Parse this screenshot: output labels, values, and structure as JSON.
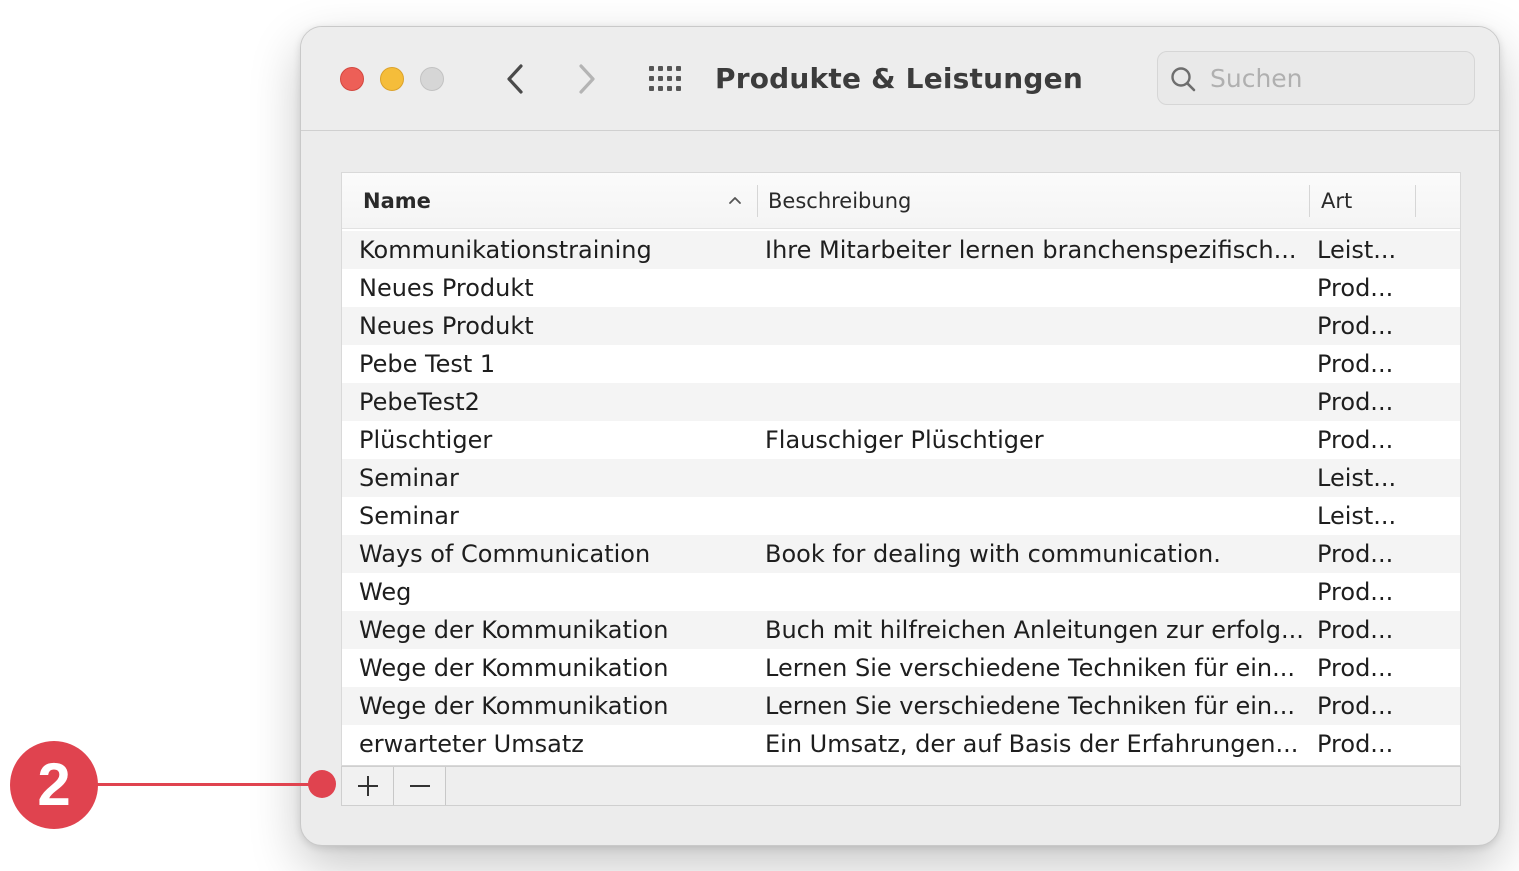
{
  "window": {
    "title": "Produkte & Leistungen",
    "search": {
      "placeholder": "Suchen",
      "value": ""
    }
  },
  "icons": {
    "close": "red-traffic-light",
    "minimize": "yellow-traffic-light",
    "zoom": "gray-traffic-light",
    "back": "chevron-left-icon",
    "forward": "chevron-right-icon",
    "grid": "grid-icon",
    "search": "magnifier-icon",
    "sort": "chevron-up-icon",
    "add": "plus-icon",
    "remove": "minus-icon"
  },
  "colors": {
    "close": "#ed5f57",
    "minimize": "#f5bd3a",
    "zoom": "#d6d6d6",
    "callout": "#e0434f"
  },
  "table": {
    "columns": {
      "name": "Name",
      "description": "Beschreibung",
      "type": "Art"
    },
    "sort": {
      "column": "name",
      "direction": "ascending"
    },
    "rows": [
      {
        "name": "Kommunikationstraining",
        "description": "Ihre Mitarbeiter lernen branchenspezifisch...",
        "type": "Leist..."
      },
      {
        "name": "Neues Produkt",
        "description": "",
        "type": "Prod..."
      },
      {
        "name": "Neues Produkt",
        "description": "",
        "type": "Prod..."
      },
      {
        "name": "Pebe Test 1",
        "description": "",
        "type": "Prod..."
      },
      {
        "name": "PebeTest2",
        "description": "",
        "type": "Prod..."
      },
      {
        "name": "Plüschtiger",
        "description": "Flauschiger Plüschtiger",
        "type": "Prod..."
      },
      {
        "name": "Seminar",
        "description": "",
        "type": "Leist..."
      },
      {
        "name": "Seminar",
        "description": "",
        "type": "Leist..."
      },
      {
        "name": "Ways of Communication",
        "description": "Book for dealing with communication.",
        "type": "Prod..."
      },
      {
        "name": "Weg",
        "description": "",
        "type": "Prod..."
      },
      {
        "name": "Wege der Kommunikation",
        "description": "Buch mit hilfreichen Anleitungen zur erfolg...",
        "type": "Prod..."
      },
      {
        "name": "Wege der Kommunikation",
        "description": "Lernen Sie verschiedene Techniken für ein...",
        "type": "Prod..."
      },
      {
        "name": "Wege der Kommunikation",
        "description": "Lernen Sie verschiedene Techniken für ein...",
        "type": "Prod..."
      },
      {
        "name": "erwarteter Umsatz",
        "description": "Ein Umsatz, der auf Basis der Erfahrungen...",
        "type": "Prod..."
      }
    ]
  },
  "callout": {
    "number": "2"
  }
}
